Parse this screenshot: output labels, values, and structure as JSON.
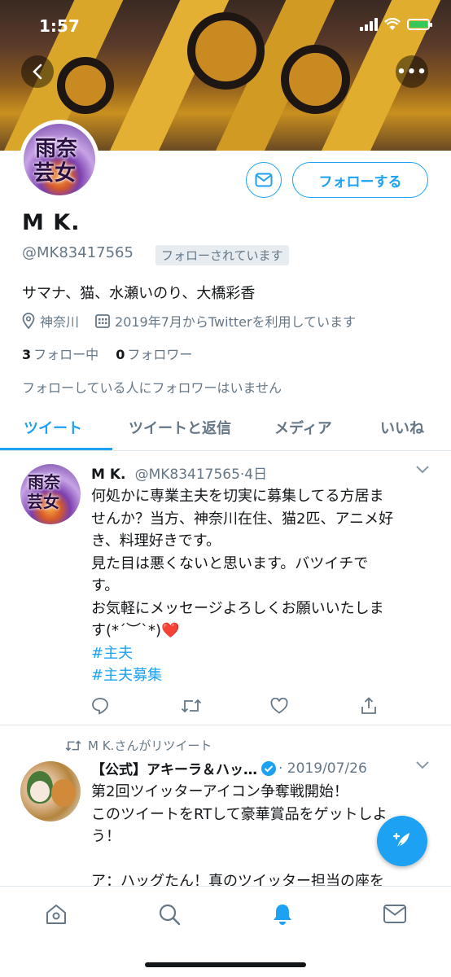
{
  "status_bar": {
    "time": "1:57"
  },
  "profile": {
    "display_name": "M K.",
    "handle": "@MK83417565",
    "follows_you": "フォローされています",
    "bio": "サマナ、猫、水瀬いのり、大橋彩香",
    "location": "神奈川",
    "joined": "2019年7月からTwitterを利用しています",
    "following_count": "3",
    "following_label": "フォロー中",
    "followers_count": "0",
    "followers_label": "フォロワー",
    "no_followers_note": "フォローしている人にフォロワーはいません",
    "follow_button": "フォローする",
    "avatar_text_top": "雨奈",
    "avatar_text_bottom": "芸女"
  },
  "tabs": [
    "ツイート",
    "ツイートと返信",
    "メディア",
    "いいね"
  ],
  "tweets": [
    {
      "name": "M K.",
      "handle": "@MK83417565",
      "time": "·4日",
      "lines": [
        "何処かに専業主夫を切実に募集してる方居ま",
        "せんか？当方、神奈川在住、猫2匹、アニメ好",
        "き、料理好きです。",
        "見た目は悪くないと思います。バツイチで",
        "す。",
        "お気軽にメッセージよろしくお願いいたしま",
        "す(*´︶`*)❤️"
      ],
      "hashtags": [
        "#主夫",
        "#主夫募集"
      ]
    },
    {
      "retweet_note": "M K.さんがリツイート",
      "name": "【公式】アキーラ＆ハッ…",
      "time": "· 2019/07/26",
      "lines": [
        "第2回ツイッターアイコン争奪戦開始！",
        "このツイートをRTして豪華賞品をゲットしよ",
        "う！",
        "",
        "ア：ハッグたん！真のツイッター担当の座を"
      ]
    }
  ],
  "colors": {
    "accent": "#1da1f2",
    "secondary_text": "#657786",
    "heart": "#e0245e"
  },
  "icons": [
    "back-icon",
    "more-icon",
    "mail-icon",
    "location-icon",
    "calendar-icon",
    "chevron-down-icon",
    "reply-icon",
    "retweet-icon",
    "like-icon",
    "share-icon",
    "compose-icon",
    "home-icon",
    "search-icon",
    "notifications-icon",
    "messages-icon",
    "verified-icon"
  ]
}
